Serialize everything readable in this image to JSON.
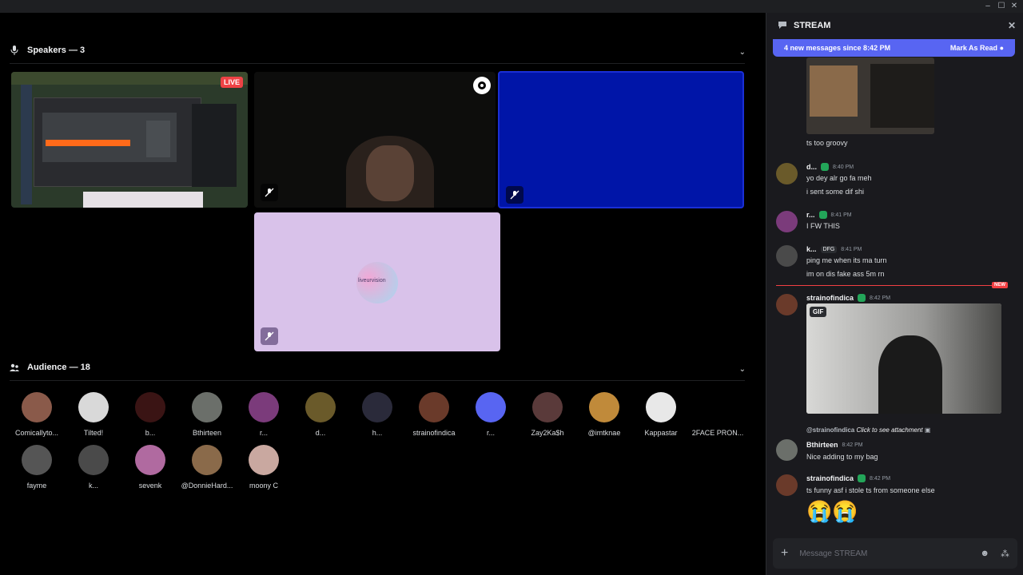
{
  "window": {
    "minimize": "–",
    "maximize": "☐",
    "close": "✕"
  },
  "speakers": {
    "heading": "Speakers — 3",
    "live_badge": "LIVE",
    "lilac_tile_text": "liveurvision"
  },
  "audience": {
    "heading": "Audience — 18",
    "members": [
      {
        "name": "Comicallyto...",
        "color": "#8a5a4a"
      },
      {
        "name": "Tilted!",
        "color": "#d9d9d9"
      },
      {
        "name": "b...",
        "color": "#3a1414"
      },
      {
        "name": "Bthirteen",
        "color": "#6b6f6a"
      },
      {
        "name": "r...",
        "color": "#7b3b7b"
      },
      {
        "name": "d...",
        "color": "#6a5a2a"
      },
      {
        "name": "h...",
        "color": "#2a2a3a"
      },
      {
        "name": "strainofindica",
        "color": "#6a3a2a"
      },
      {
        "name": "r...",
        "color": "#5865f2"
      },
      {
        "name": "Zay2Ka$h",
        "color": "#5a3a3a"
      },
      {
        "name": "@imtknae",
        "color": "#c08a3a"
      },
      {
        "name": "Kappastar",
        "color": "#e8e8e8"
      },
      {
        "name": "2FACE PRON...",
        "color": "#000000"
      },
      {
        "name": "fayme",
        "color": "#555555"
      },
      {
        "name": "k...",
        "color": "#4a4a4a"
      },
      {
        "name": "sevenk",
        "color": "#b06aa0"
      },
      {
        "name": "@DonnieHard...",
        "color": "#8a6a4a"
      },
      {
        "name": "moony C",
        "color": "#c9a8a0"
      }
    ]
  },
  "chat": {
    "title": "STREAM",
    "banner_left": "4 new messages since 8:42 PM",
    "banner_right": "Mark As Read",
    "messages": [
      {
        "text": "ts too groovy"
      },
      {
        "user": "d...",
        "time": "8:40 PM",
        "lines": [
          "yo dey alr go fa meh",
          "i sent some dif shi"
        ]
      },
      {
        "user": "r...",
        "time": "8:41 PM",
        "lines": [
          "I FW THIS"
        ]
      },
      {
        "user": "k...",
        "tag": "DFG",
        "time": "8:41 PM",
        "lines": [
          "ping me when its ma turn",
          "im on dis fake ass 5m rn"
        ]
      },
      {
        "new_label": "NEW"
      },
      {
        "user": "strainofindica",
        "time": "8:42 PM",
        "gif": "GIF"
      },
      {
        "reply_user": "@strainofindica",
        "reply_text": "Click to see attachment",
        "user": "Bthirteen",
        "time": "8:42 PM",
        "lines": [
          "Nice adding to my bag"
        ]
      },
      {
        "user": "strainofindica",
        "time": "8:42 PM",
        "lines": [
          "ts funny asf i stole ts from someone else"
        ],
        "emoji": "😭😭"
      }
    ],
    "input_placeholder": "Message STREAM"
  }
}
